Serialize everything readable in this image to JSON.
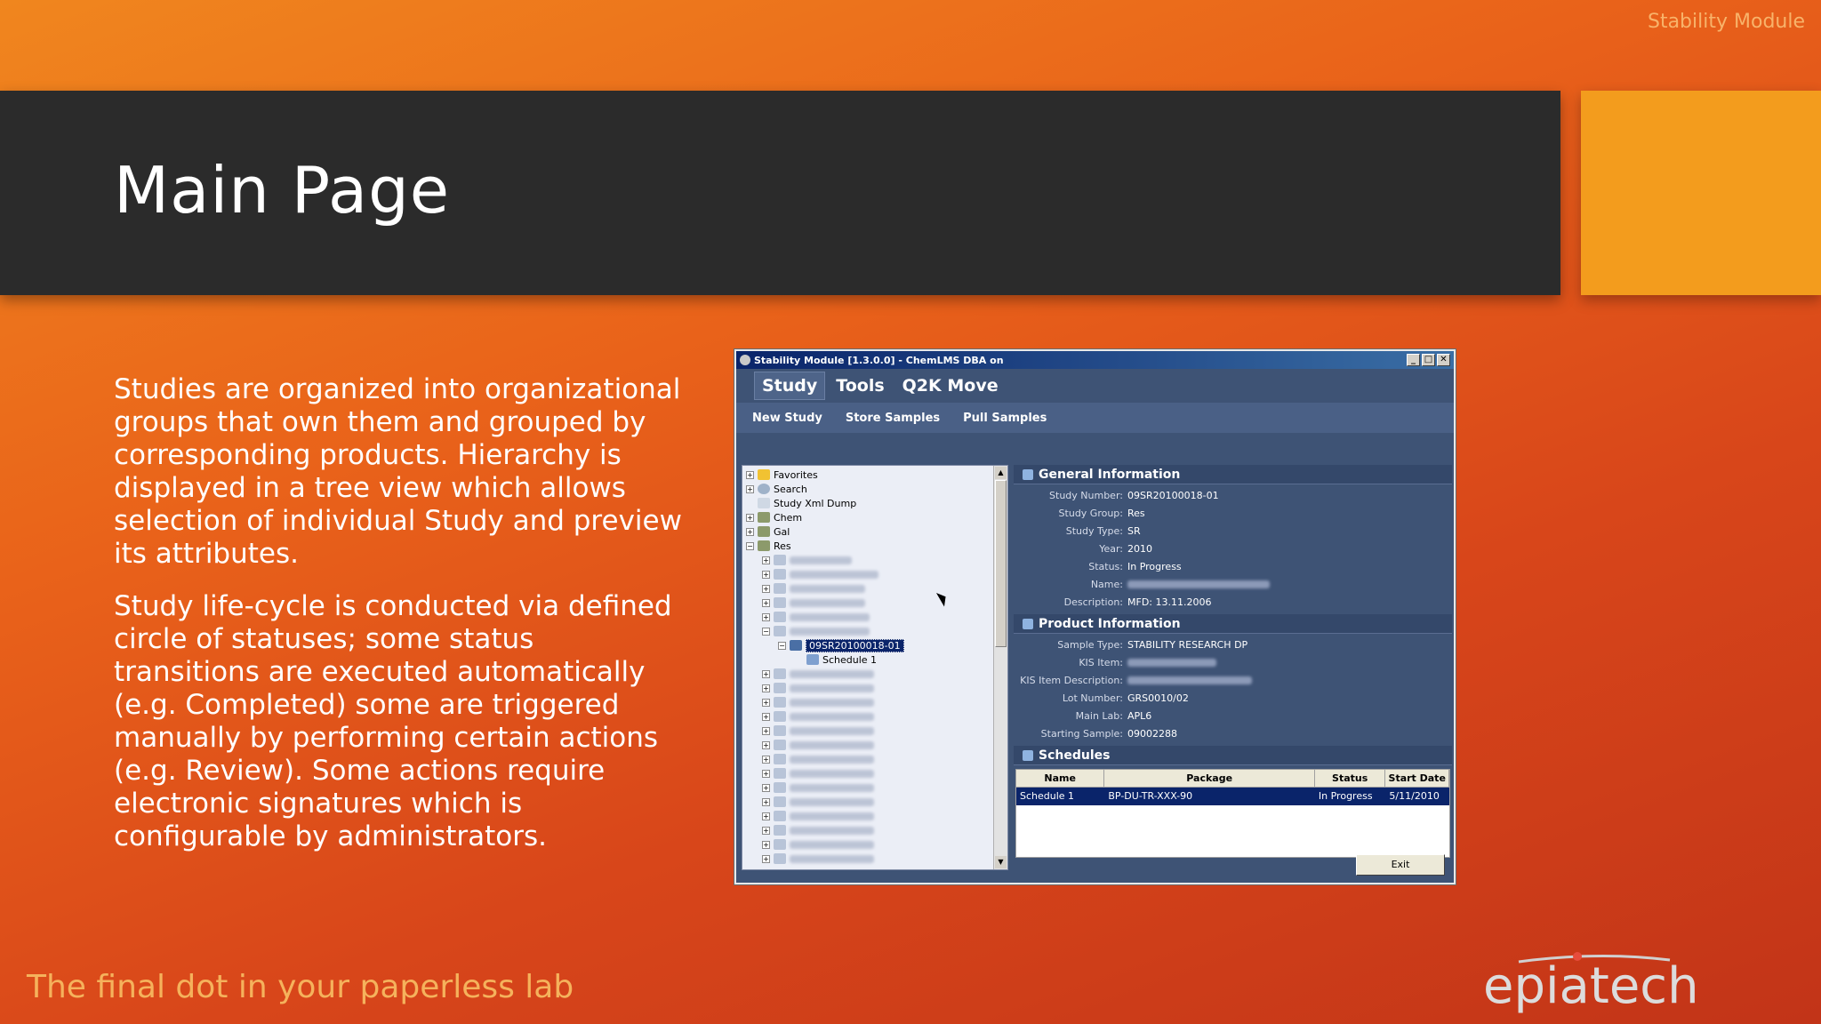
{
  "corner_label": "Stability Module",
  "slide_title": "Main Page",
  "paragraphs": [
    "Studies are organized into organizational groups that own them and grouped by corresponding products. Hierarchy is displayed in a tree view which allows selection of individual Study and preview its attributes.",
    "Study life-cycle is conducted via defined circle of statuses; some status transitions are executed automatically (e.g. Completed) some are triggered manually by performing certain actions (e.g. Review). Some actions require electronic signatures which is configurable by administrators."
  ],
  "tagline": "The final dot in your paperless lab",
  "logo_text": "epiatech",
  "window": {
    "title": "Stability Module [1.3.0.0] - ChemLMS DBA on",
    "controls": [
      "_",
      "□",
      "✕"
    ]
  },
  "menu": [
    "Study",
    "Tools",
    "Q2K Move"
  ],
  "toolbar": [
    "New Study",
    "Store Samples",
    "Pull Samples"
  ],
  "tree": {
    "top_items": [
      "Favorites",
      "Search",
      "Study Xml Dump",
      "Chem",
      "Gal",
      "Res"
    ],
    "selected_study": "09SR20100018-01",
    "schedule_child": "Schedule 1"
  },
  "general_info": {
    "header": "General Information",
    "fields": [
      {
        "label": "Study Number:",
        "value": "09SR20100018-01"
      },
      {
        "label": "Study Group:",
        "value": "Res"
      },
      {
        "label": "Study Type:",
        "value": "SR"
      },
      {
        "label": "Year:",
        "value": "2010"
      },
      {
        "label": "Status:",
        "value": "In Progress"
      },
      {
        "label": "Name:",
        "value": ""
      },
      {
        "label": "Description:",
        "value": "MFD: 13.11.2006"
      }
    ]
  },
  "product_info": {
    "header": "Product Information",
    "fields": [
      {
        "label": "Sample Type:",
        "value": "STABILITY RESEARCH DP"
      },
      {
        "label": "KIS Item:",
        "value": ""
      },
      {
        "label": "KIS Item Description:",
        "value": ""
      },
      {
        "label": "Lot Number:",
        "value": "GRS0010/02"
      },
      {
        "label": "Main Lab:",
        "value": "APL6"
      },
      {
        "label": "Starting Sample:",
        "value": "09002288"
      }
    ]
  },
  "schedules": {
    "header": "Schedules",
    "columns": [
      "Name",
      "Package",
      "Status",
      "Start Date"
    ],
    "rows": [
      [
        "Schedule 1",
        "BP-DU-TR-XXX-90",
        "In Progress",
        "5/11/2010"
      ]
    ]
  },
  "exit_label": "Exit",
  "colors": {
    "accent": "#f39c1d",
    "title_bar": "#2b2b2b",
    "app_bg": "#3e5375",
    "selection": "#0a246a"
  }
}
